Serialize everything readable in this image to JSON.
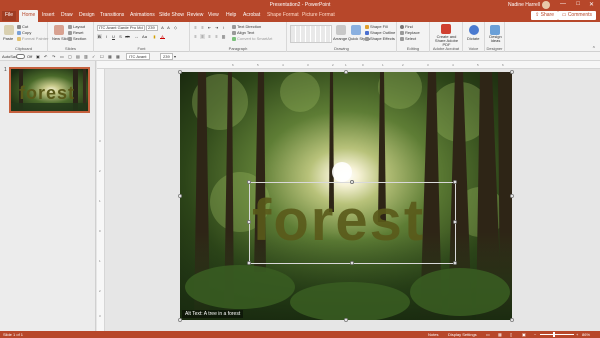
{
  "titlebar": {
    "title": "Presentation2 - PowerPoint",
    "user": "Nadine Harrell",
    "minimize": "—",
    "restore": "□",
    "close": "✕"
  },
  "tabs": [
    {
      "label": "File"
    },
    {
      "label": "Home"
    },
    {
      "label": "Insert"
    },
    {
      "label": "Draw"
    },
    {
      "label": "Design"
    },
    {
      "label": "Transitions"
    },
    {
      "label": "Animations"
    },
    {
      "label": "Slide Show"
    },
    {
      "label": "Review"
    },
    {
      "label": "View"
    },
    {
      "label": "Help"
    },
    {
      "label": "Acrobat"
    },
    {
      "label": "Shape Format"
    },
    {
      "label": "Picture Format"
    }
  ],
  "share_label": "Share",
  "comments_label": "Comments",
  "ribbon": {
    "clipboard": {
      "label": "Clipboard",
      "paste": "Paste",
      "cut": "Cut",
      "copy": "Copy",
      "format_painter": "Format Painter"
    },
    "slides": {
      "label": "Slides",
      "new_slide": "New Slide",
      "layout": "Layout",
      "reset": "Reset",
      "section": "Section"
    },
    "font": {
      "label": "Font",
      "font_name": "ITC Avant Garde Pro Md",
      "font_size": "239",
      "bold": "B",
      "italic": "I",
      "underline": "U",
      "strike": "S"
    },
    "paragraph": {
      "label": "Paragraph",
      "text_direction": "Text Direction",
      "align_text": "Align Text",
      "smartart": "Convert to SmartArt"
    },
    "drawing": {
      "label": "Drawing",
      "arrange": "Arrange",
      "quick_styles": "Quick Styles",
      "shape_fill": "Shape Fill",
      "shape_outline": "Shape Outline",
      "shape_effects": "Shape Effects"
    },
    "editing": {
      "label": "Editing",
      "find": "Find",
      "replace": "Replace",
      "select": "Select"
    },
    "adobe": {
      "label": "Adobe Acrobat",
      "create_share": "Create and Share Adobe PDF"
    },
    "voice": {
      "label": "Voice",
      "dictate": "Dictate"
    },
    "designer": {
      "label": "Designer",
      "design_ideas": "Design Ideas"
    }
  },
  "qat": {
    "autosave": "AutoSave",
    "off": "Off",
    "font_name": "ITC Avant",
    "font_size": "239"
  },
  "thumb_panel": {
    "slide_number": "1",
    "thumb_word": "forest"
  },
  "ruler_ticks": {
    "h": [
      "6",
      "5",
      "4",
      "3",
      "2",
      "1",
      "0",
      "1",
      "2",
      "3",
      "4",
      "5",
      "6"
    ],
    "v": [
      "3",
      "2",
      "1",
      "0",
      "1",
      "2",
      "3"
    ]
  },
  "slide": {
    "word": "forest",
    "alt_text": "Alt Text: A tree in a forest"
  },
  "status": {
    "slide_of": "Slide 1 of 1",
    "notes": "Notes",
    "display_settings": "Display Settings",
    "zoom": "86%"
  },
  "colors": {
    "accent": "#b7472a",
    "text_fill": "#5a5a1a"
  }
}
